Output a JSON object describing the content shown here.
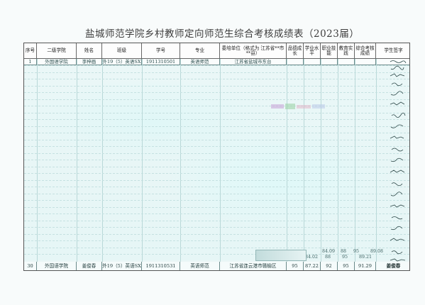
{
  "title": "盐城师范学院乡村教师定向师范生综合考核成绩表（2023届）",
  "headers": [
    "序号",
    "二级学院",
    "姓名",
    "班级",
    "学号",
    "专业",
    "委培单位（格式为 江苏省**市**县）",
    "品德成长",
    "学业水平",
    "职业技能",
    "教育实践",
    "综合考核成绩",
    "学生签字"
  ],
  "rows": [
    {
      "no": "1",
      "college": "外国语学院",
      "name": "李梓画",
      "class": "外19（5）英语SX",
      "id": "1911310501",
      "major": "英语师范",
      "unit": "江苏省盐城市东台",
      "moral": "",
      "academic": "",
      "skill": "",
      "practice": "",
      "total": ""
    },
    {
      "no": "30",
      "college": "外国语学院",
      "name": "姜俊春",
      "class": "外19（5）英语SX",
      "id": "1911310531",
      "major": "英语师范",
      "unit": "江苏省连云港市赣榆区",
      "moral": "95",
      "academic": "87.22",
      "skill": "92",
      "practice": "95",
      "total": "91.29"
    }
  ],
  "partial_scores": [
    {
      "academic": "84.09",
      "skill": "88",
      "practice": "95",
      "total": "89.08"
    },
    {
      "academic": "84.02",
      "skill": "88",
      "practice": "95",
      "total": "89.21"
    }
  ],
  "signature_last": "姜俊春"
}
